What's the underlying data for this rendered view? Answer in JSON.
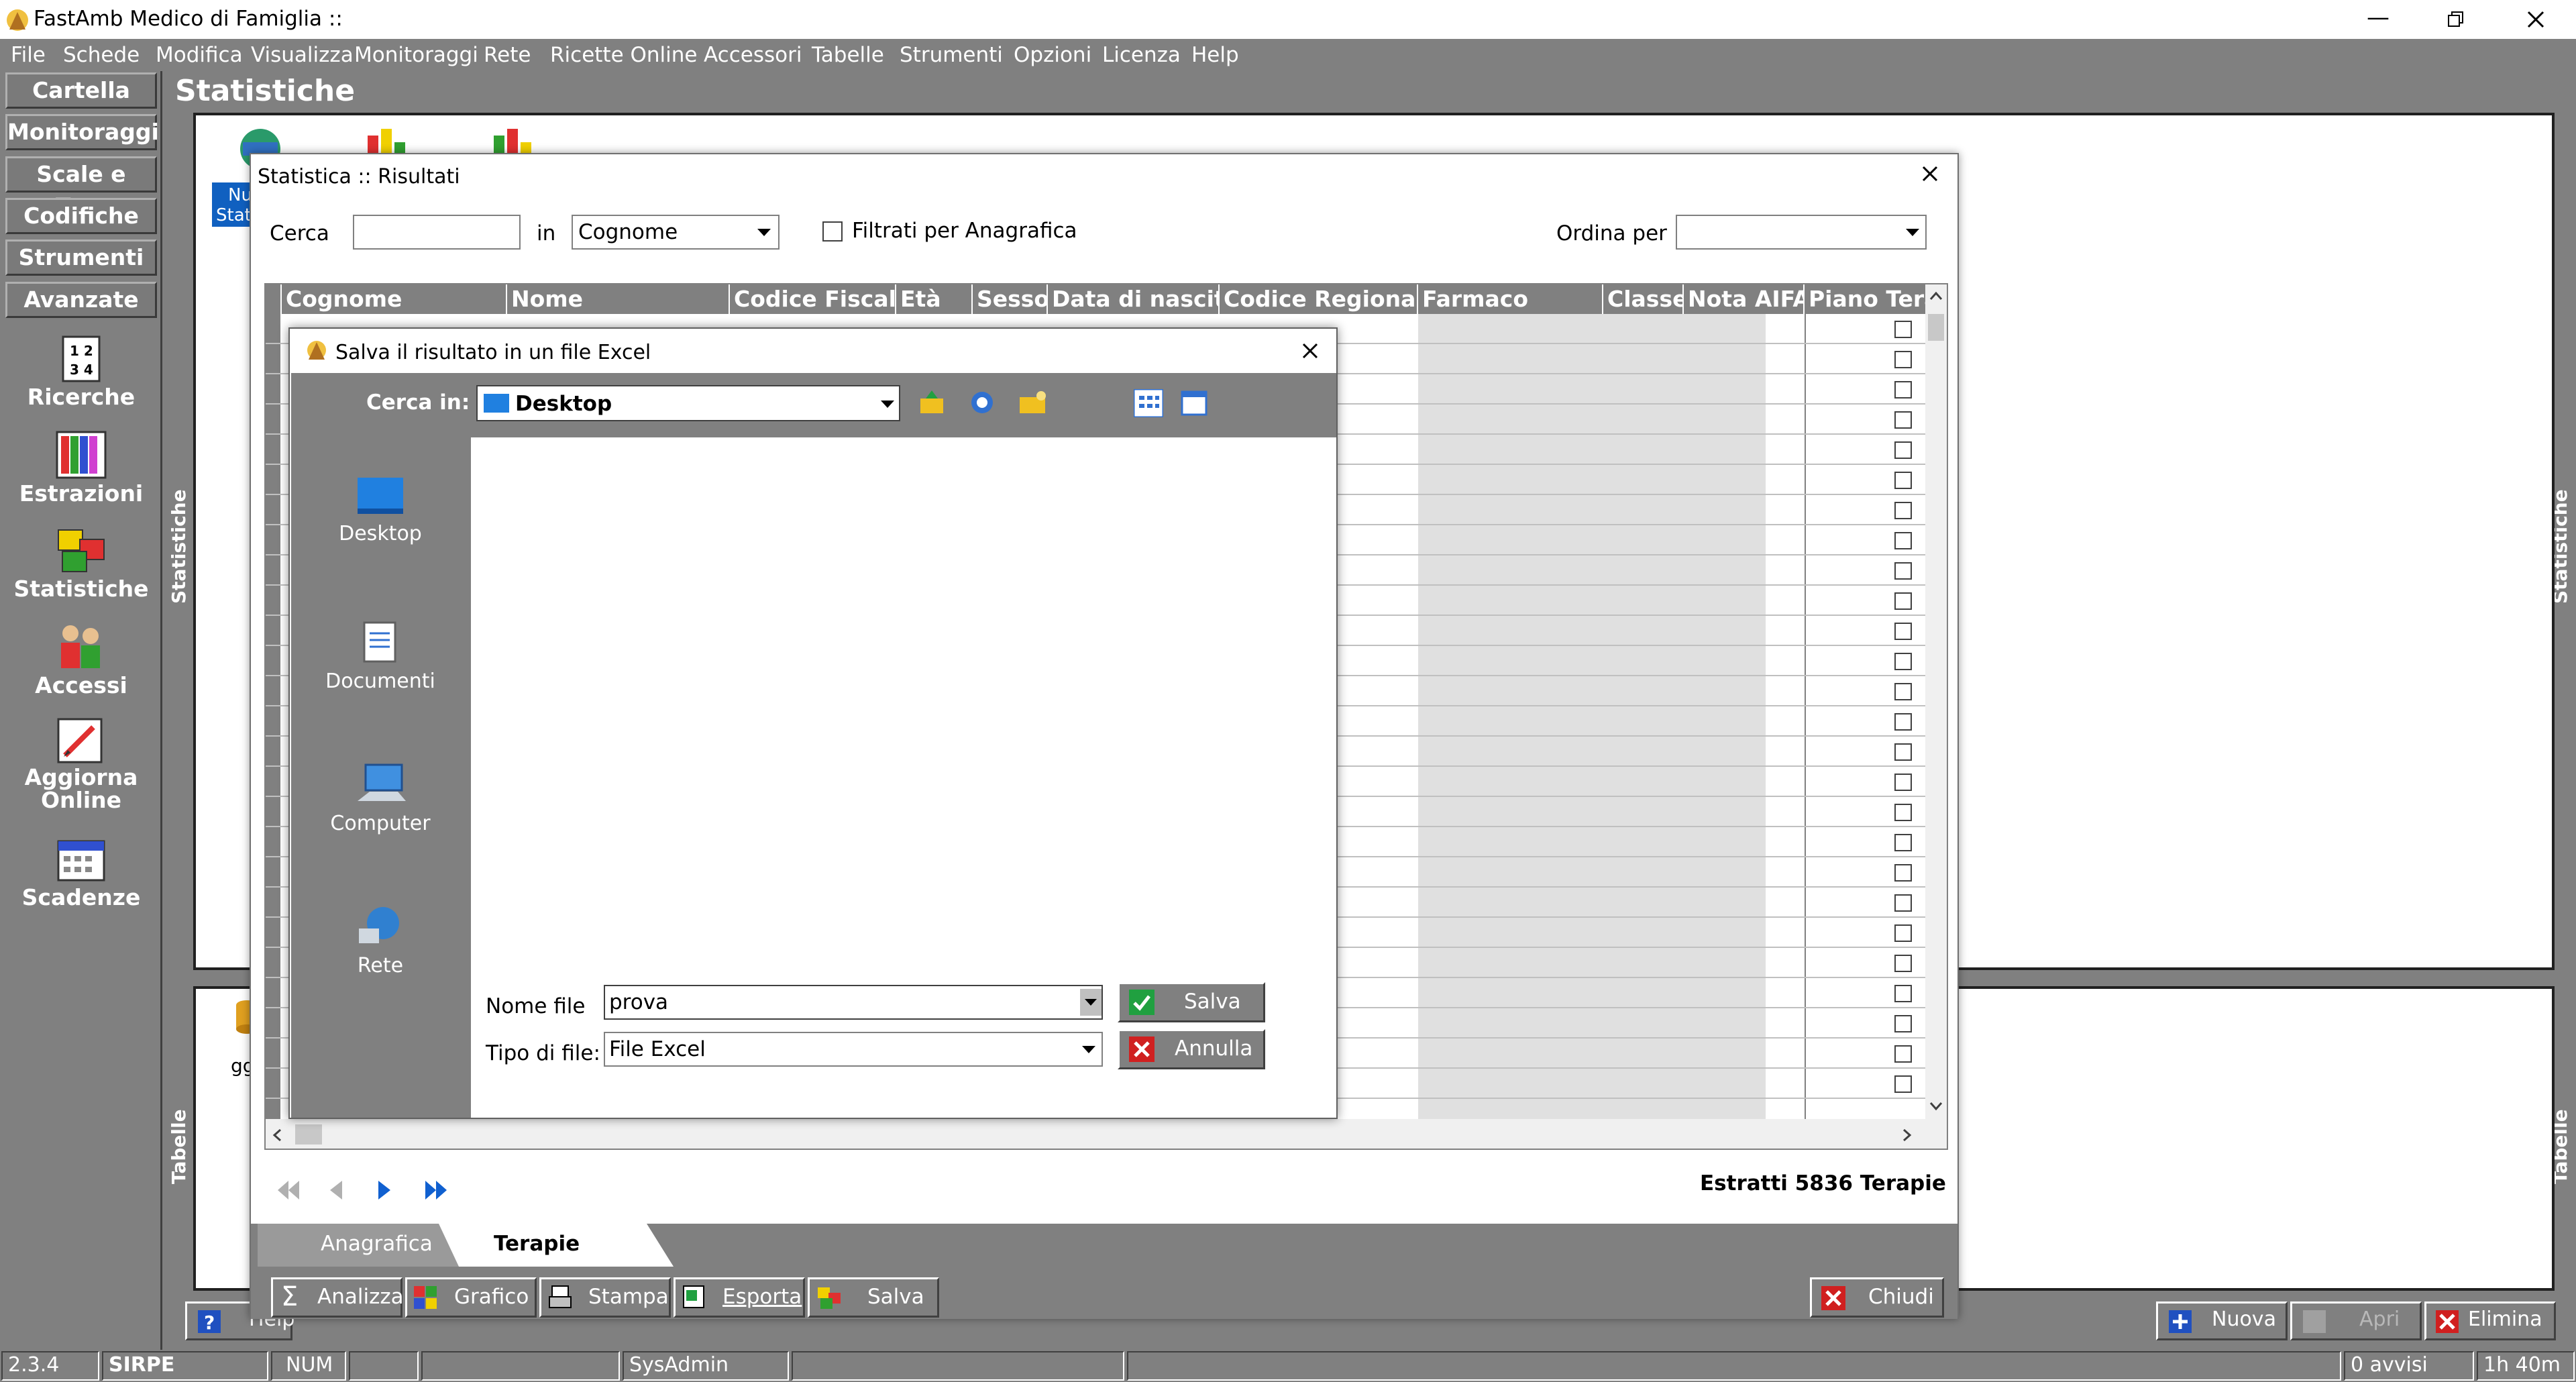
{
  "app": {
    "title": "FastAmb Medico di Famiglia ::"
  },
  "menu": [
    "File",
    "Schede",
    "Modifica",
    "Visualizza",
    "Monitoraggi",
    "Rete",
    "Ricette Online",
    "Accessori",
    "Tabelle",
    "Strumenti",
    "Opzioni",
    "Licenza",
    "Help"
  ],
  "nav": {
    "buttons": [
      "Cartella",
      "Monitoraggi",
      "Scale e Test",
      "Codifiche",
      "Strumenti",
      "Avanzate"
    ],
    "tools": {
      "ricerche": "Ricerche",
      "estrazioni": "Estrazioni",
      "statistiche": "Statistiche",
      "accessi": "Accessi",
      "aggiorna1": "Aggiorna",
      "aggiorna2": "Online",
      "scadenze": "Scadenze"
    }
  },
  "panel": {
    "title": "Statistiche",
    "side_label_top": "Statistiche",
    "side_label_bottom": "Tabelle",
    "bg_text1": "Nu",
    "bg_text2": "Stat",
    "bg_text3": "gg",
    "help_label": "Help"
  },
  "results": {
    "title": "Statistica :: Risultati",
    "search_label": "Cerca",
    "search_value": "",
    "in_label": "in",
    "field_value": "Cognome",
    "filter_label": "Filtrati per Anagrafica",
    "order_label": "Ordina per",
    "order_value": "",
    "columns": [
      "Cognome",
      "Nome",
      "Codice Fiscale",
      "Età",
      "Sesso",
      "Data di nascita",
      "Codice Regionale",
      "Farmaco",
      "Classe",
      "Nota AIFA",
      "Piano Tera"
    ],
    "extracted": "Estratti 5836 Terapie",
    "tabs": [
      "Anagrafica",
      "Terapie"
    ],
    "buttons": {
      "analizza": "Analizza",
      "grafico": "Grafico",
      "stampa": "Stampa",
      "esporta": "Esporta",
      "salva": "Salva",
      "chiudi": "Chiudi"
    }
  },
  "save_dialog": {
    "title": "Salva il risultato in un file Excel",
    "look_in_label": "Cerca in:",
    "look_in_value": "Desktop",
    "places": [
      "Desktop",
      "Documenti",
      "Computer",
      "Rete"
    ],
    "filename_label": "Nome file",
    "filename_value": "prova",
    "filetype_label": "Tipo di file:",
    "filetype_value": "File Excel",
    "save_button": "Salva",
    "cancel_button": "Annulla"
  },
  "bottom_buttons": {
    "nuova": "Nuova",
    "apri": "Apri",
    "elimina": "Elimina"
  },
  "status": [
    "2.3.4",
    "SIRPE",
    "NUM",
    "",
    "",
    "SysAdmin",
    "",
    "",
    "0 avvisi",
    "1h 40m"
  ]
}
